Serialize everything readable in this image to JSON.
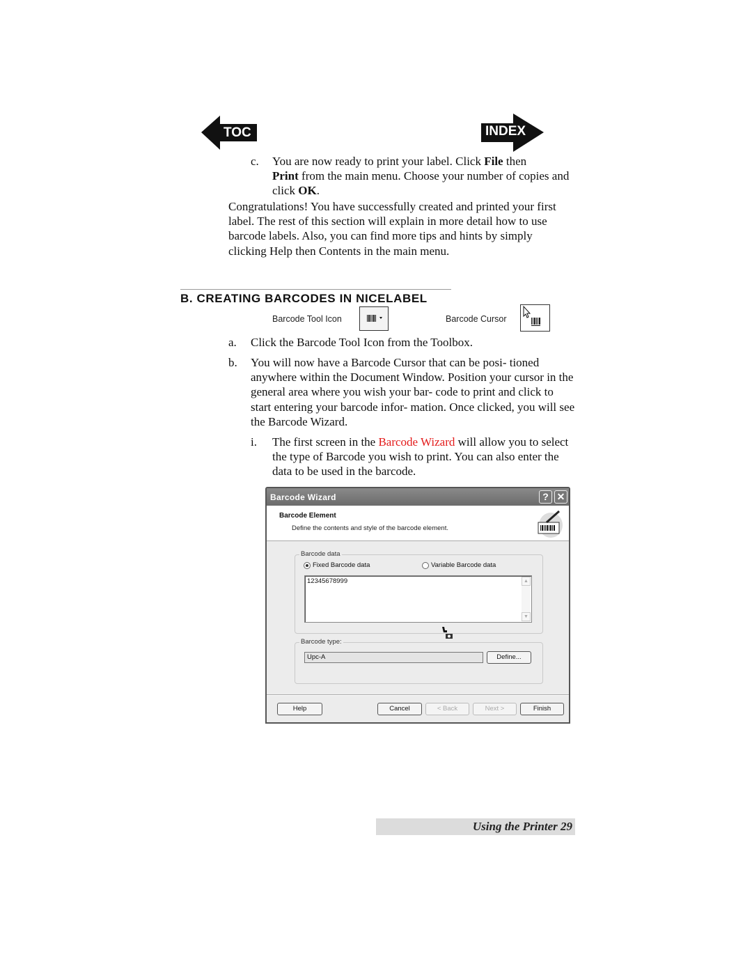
{
  "nav": {
    "toc_label": "TOC",
    "index_label": "INDEX"
  },
  "step_c": {
    "marker": "c.",
    "text_1": "You are now ready to print your label.  Click ",
    "bold_file": "File",
    "text_2": " then",
    "bold_print": "Print",
    "text_3": " from the main menu.  Choose your number of copies and click ",
    "bold_ok": "OK",
    "text_4": "."
  },
  "congrats_paragraph": "Congratulations! You have successfully created and printed your first label.  The rest of this section will explain in more detail how to use barcode labels.  Also, you can find more tips and hints by simply clicking Help then Contents in the main menu.",
  "section": {
    "heading": "B. CREATING BARCODES IN NICELABEL",
    "tool_icon_label": "Barcode Tool Icon",
    "cursor_label": "Barcode Cursor"
  },
  "steps": [
    {
      "marker": "a.",
      "text": "Click the Barcode Tool Icon from the Toolbox."
    },
    {
      "marker": "b.",
      "text": "You will now have a Barcode Cursor that can be posi- tioned anywhere within the Document Window.  Position your cursor in the general area where you wish your bar- code to print and click to start entering your barcode infor- mation.  Once clicked, you will see the Barcode Wizard."
    }
  ],
  "substep_i": {
    "marker": "i.",
    "text_1": "The first screen in the ",
    "link": "Barcode Wizard",
    "text_2": " will allow you to select the type of Barcode you wish to print.  You can also enter the data to be used in the barcode."
  },
  "colors": {
    "link_red": "#e31b1b"
  },
  "dialog": {
    "title": "Barcode Wizard",
    "help_glyph": "?",
    "close_glyph": "✕",
    "header_title": "Barcode Element",
    "header_subtitle": "Define the contents and style of the barcode element.",
    "barcode_data_group": "Barcode data",
    "radio_fixed": "Fixed Barcode data",
    "radio_variable": "Variable Barcode data",
    "selected_radio": "Fixed Barcode data",
    "data_value": "12345678999",
    "barcode_type_group": "Barcode type:",
    "barcode_type_value": "Upc-A",
    "define_button": "Define...",
    "buttons": {
      "help": "Help",
      "cancel": "Cancel",
      "back": "< Back",
      "next": "Next >",
      "finish": "Finish"
    }
  },
  "footer": {
    "text": "Using the Printer  29"
  }
}
